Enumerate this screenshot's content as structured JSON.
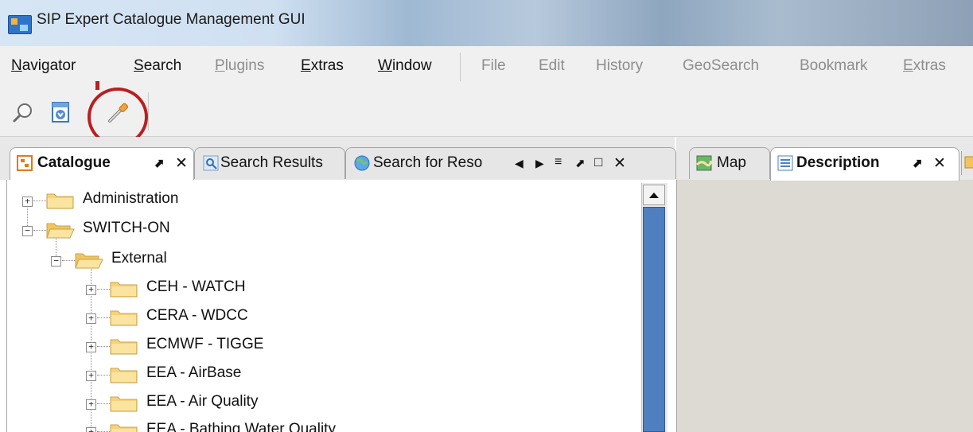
{
  "window": {
    "title": "SIP Expert Catalogue Management GUI",
    "accent": "#2f74c7"
  },
  "menubar": {
    "items": [
      {
        "label": "Navigator",
        "underline": "N",
        "rest": "avigator",
        "enabled": true
      },
      {
        "label": "Search",
        "underline": "S",
        "rest": "earch",
        "enabled": true
      },
      {
        "label": "Plugins",
        "underline": "P",
        "rest": "lugins",
        "enabled": false
      },
      {
        "label": "Extras",
        "underline": "E",
        "rest": "xtras",
        "enabled": true
      },
      {
        "label": "Window",
        "underline": "W",
        "rest": "indow",
        "enabled": true
      },
      {
        "label": "File",
        "enabled": false
      },
      {
        "label": "Edit",
        "enabled": false
      },
      {
        "label": "History",
        "enabled": false
      },
      {
        "label": "GeoSearch",
        "enabled": false
      },
      {
        "label": "Bookmark",
        "enabled": false
      },
      {
        "label": "Extras",
        "underline": "E",
        "rest": "xtras",
        "enabled": false
      }
    ]
  },
  "toolbar": {
    "buttons": [
      {
        "icon": "magnifier-icon"
      },
      {
        "icon": "download-window-icon"
      },
      {
        "icon": "pipette-icon",
        "highlighted": true
      }
    ],
    "highlight_color": "#b82020"
  },
  "left_view": {
    "tabs": [
      {
        "label": "Catalogue",
        "icon": "catalogue-icon",
        "active": true
      },
      {
        "label": "Search Results",
        "icon": "search-results-icon",
        "active": false
      },
      {
        "label": "Search for Reso",
        "icon": "globe-icon",
        "active": false
      }
    ],
    "tree": [
      {
        "label": "Administration",
        "level": 0,
        "expanded": false
      },
      {
        "label": "SWITCH-ON",
        "level": 0,
        "expanded": true
      },
      {
        "label": "External",
        "level": 1,
        "expanded": true
      },
      {
        "label": "CEH - WATCH",
        "level": 2,
        "expanded": false
      },
      {
        "label": "CERA - WDCC",
        "level": 2,
        "expanded": false
      },
      {
        "label": "ECMWF - TIGGE",
        "level": 2,
        "expanded": false
      },
      {
        "label": "EEA - AirBase",
        "level": 2,
        "expanded": false
      },
      {
        "label": "EEA - Air Quality",
        "level": 2,
        "expanded": false
      },
      {
        "label": "EEA - Bathing Water Quality",
        "level": 2,
        "expanded": false
      }
    ]
  },
  "right_view": {
    "tabs": [
      {
        "label": "Map",
        "icon": "map-icon",
        "active": false
      },
      {
        "label": "Description",
        "icon": "description-icon",
        "active": true
      }
    ]
  }
}
